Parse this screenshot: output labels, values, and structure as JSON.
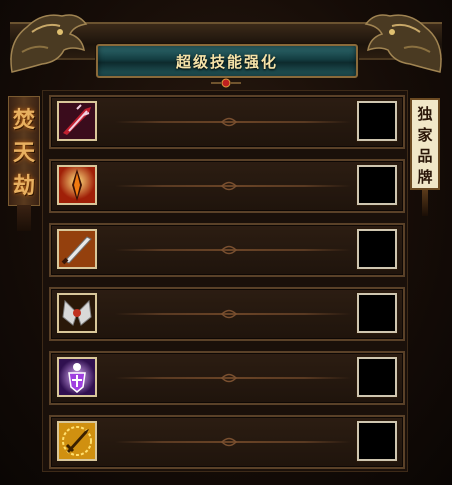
{
  "title": "超级技能强化",
  "left_banner": [
    "焚",
    "天",
    "劫"
  ],
  "right_banner": [
    "独",
    "家",
    "品",
    "牌"
  ],
  "skills": [
    {
      "icon": "red-blade-slash-icon",
      "colors": [
        "#4a1020",
        "#c02030",
        "#f0d0e0"
      ]
    },
    {
      "icon": "flaming-spear-icon",
      "colors": [
        "#7a1808",
        "#f07a10",
        "#ffe080"
      ]
    },
    {
      "icon": "silver-dagger-icon",
      "colors": [
        "#3a1808",
        "#b05010",
        "#e8e8e8"
      ]
    },
    {
      "icon": "spiked-axes-icon",
      "colors": [
        "#2a1808",
        "#c03020",
        "#d8d8d8"
      ]
    },
    {
      "icon": "holy-shield-figure-icon",
      "colors": [
        "#301050",
        "#a040e0",
        "#ffffff"
      ]
    },
    {
      "icon": "golden-sword-rune-icon",
      "colors": [
        "#3a2000",
        "#d09010",
        "#ffe070"
      ]
    }
  ]
}
